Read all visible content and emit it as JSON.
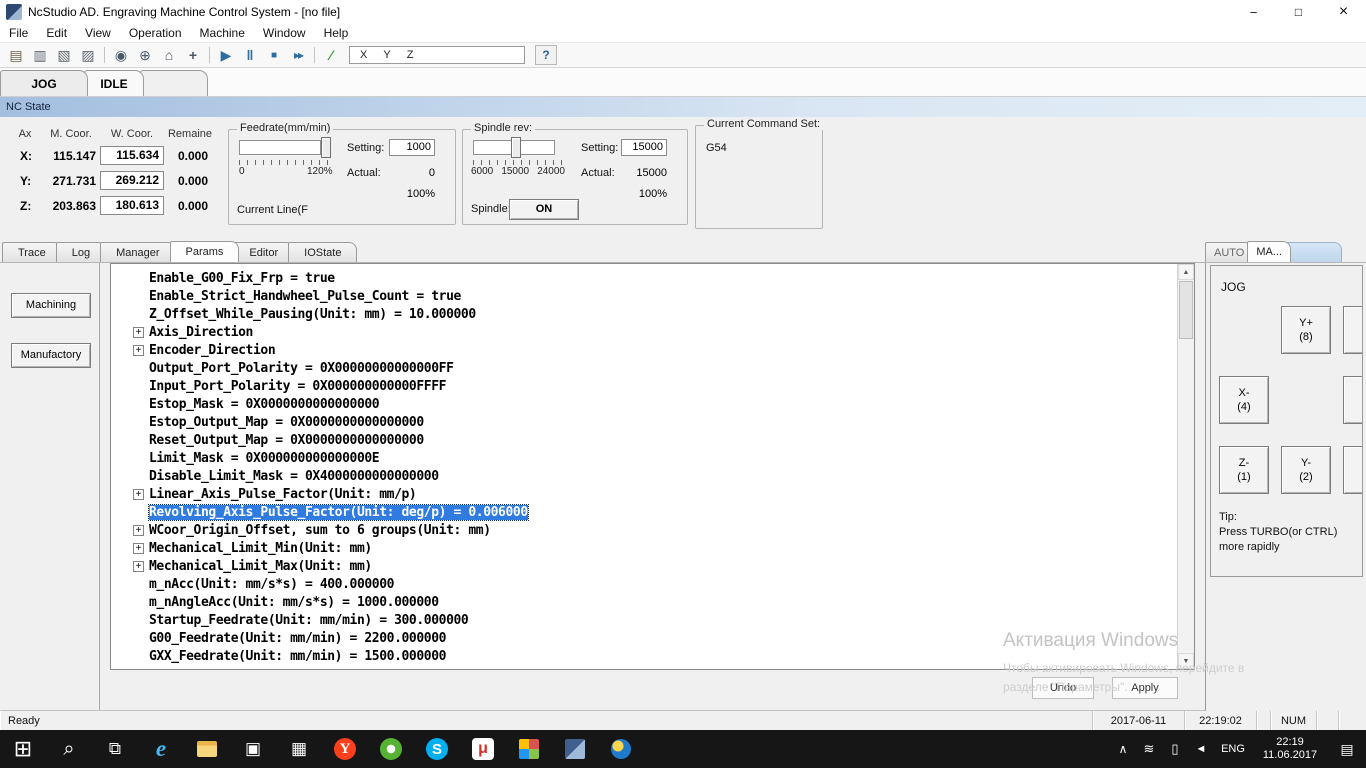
{
  "titlebar": {
    "title": "NcStudio AD. Engraving Machine Control System - [no file]"
  },
  "menubar": {
    "items": [
      {
        "label": "File"
      },
      {
        "label": "Edit"
      },
      {
        "label": "View"
      },
      {
        "label": "Operation"
      },
      {
        "label": "Machine"
      },
      {
        "label": "Window"
      },
      {
        "label": "Help"
      }
    ]
  },
  "toolbar": {
    "icons": [
      {
        "name": "open-file-icon",
        "glyph": "▤",
        "style": "color:#6b5f49",
        "inter": "true"
      },
      {
        "name": "save-icon",
        "glyph": "▥",
        "style": "color:#5f6670",
        "inter": "true"
      },
      {
        "name": "layout-icon",
        "glyph": "▧",
        "style": "color:#5f6670",
        "inter": "true"
      },
      {
        "name": "screen-icon",
        "glyph": "▨",
        "style": "color:#5f6670",
        "inter": "true"
      },
      {
        "name": "separator",
        "glyph": "",
        "style": "width:1px;height:16px;background:#c4c4c4;margin:0 4px",
        "inter": "false"
      },
      {
        "name": "handwheel-icon",
        "glyph": "◉",
        "style": "color:#4a5a6a",
        "inter": "true"
      },
      {
        "name": "origin-icon",
        "glyph": "⊕",
        "style": "color:#4a5a6a",
        "inter": "true"
      },
      {
        "name": "home-icon",
        "glyph": "⌂",
        "style": "color:#4a5a6a",
        "inter": "true"
      },
      {
        "name": "calibrate-icon",
        "glyph": "+",
        "style": "color:#4a5a6a;font-weight:bold",
        "inter": "true"
      },
      {
        "name": "separator",
        "glyph": "",
        "style": "width:1px;height:16px;background:#c4c4c4;margin:0 4px",
        "inter": "false"
      },
      {
        "name": "start-button",
        "glyph": "▶",
        "style": "color:#2e6da0",
        "inter": "true"
      },
      {
        "name": "pause-button",
        "glyph": "‖",
        "style": "color:#2e6da0;font-weight:bold",
        "inter": "true"
      },
      {
        "name": "stop-button",
        "glyph": "■",
        "style": "color:#2e6da0;font-size:10px",
        "inter": "true"
      },
      {
        "name": "resume-button",
        "glyph": "▸▸",
        "style": "color:#2e6da0;letter-spacing:-2px;font-size:12px",
        "inter": "true"
      },
      {
        "name": "separator",
        "glyph": "",
        "style": "width:1px;height:16px;background:#c4c4c4;margin:0 4px",
        "inter": "false"
      },
      {
        "name": "slash-icon",
        "glyph": "∕",
        "style": "color:#3f9f3f;font-weight:bold",
        "inter": "true"
      }
    ],
    "coord_labels": [
      {
        "label": "X"
      },
      {
        "label": "Y"
      },
      {
        "label": "Z"
      }
    ],
    "help_label": "?"
  },
  "mode_tabs": {
    "jog": "JOG",
    "idle": "IDLE"
  },
  "nc_state_label": "NC State",
  "coords": {
    "headers": {
      "axis": "Ax",
      "m": "M. Coor.",
      "w": "W. Coor.",
      "rem": "Remaine"
    },
    "rows": [
      {
        "axis": "X:",
        "m": "115.147",
        "w": "115.634",
        "rem": "0.000"
      },
      {
        "axis": "Y:",
        "m": "271.731",
        "w": "269.212",
        "rem": "0.000"
      },
      {
        "axis": "Z:",
        "m": "203.863",
        "w": "180.613",
        "rem": "0.000"
      }
    ]
  },
  "feedrate": {
    "title": "Feedrate(mm/min)",
    "scale_left": "0",
    "scale_right": "120%",
    "setting_label": "Setting:",
    "setting_value": "1000",
    "actual_label": "Actual:",
    "actual_value": "0",
    "percent": "100%",
    "current_line": "Current Line(F"
  },
  "spindle": {
    "title": "Spindle rev:",
    "scale": [
      {
        "label": "6000"
      },
      {
        "label": "15000"
      },
      {
        "label": "24000"
      }
    ],
    "setting_label": "Setting:",
    "setting_value": "15000",
    "actual_label": "Actual:",
    "actual_value": "15000",
    "percent": "100%",
    "spindle_label": "Spindle:",
    "on_label": "ON"
  },
  "command_set": {
    "title": "Current Command Set:",
    "value": "G54"
  },
  "bottom_tabs": {
    "items": [
      {
        "label": "Trace"
      },
      {
        "label": "Log"
      },
      {
        "label": "Manager"
      },
      {
        "label": "Params",
        "active": true
      },
      {
        "label": "Editor"
      },
      {
        "label": "IOState"
      }
    ]
  },
  "sidebar": {
    "machining": "Machining",
    "manufactory": "Manufactory"
  },
  "params": {
    "items": [
      {
        "text": "Enable_G00_Fix_Frp = true",
        "inter": "true"
      },
      {
        "text": "Enable_Strict_Handwheel_Pulse_Count = true",
        "inter": "true"
      },
      {
        "text": "Z_Offset_While_Pausing(Unit: mm) = 10.000000",
        "inter": "true"
      },
      {
        "text": "Axis_Direction",
        "expandable": true,
        "inter": "true"
      },
      {
        "text": "Encoder_Direction",
        "expandable": true,
        "inter": "true"
      },
      {
        "text": "Output_Port_Polarity = 0X00000000000000FF",
        "inter": "true"
      },
      {
        "text": "Input_Port_Polarity = 0X000000000000FFFF",
        "inter": "true"
      },
      {
        "text": "Estop_Mask = 0X0000000000000000",
        "inter": "true"
      },
      {
        "text": "Estop_Output_Map = 0X0000000000000000",
        "inter": "true"
      },
      {
        "text": "Reset_Output_Map = 0X0000000000000000",
        "inter": "true"
      },
      {
        "text": "Limit_Mask = 0X000000000000000E",
        "inter": "true"
      },
      {
        "text": "Disable_Limit_Mask = 0X4000000000000000",
        "inter": "true"
      },
      {
        "text": "Linear_Axis_Pulse_Factor(Unit: mm/p)",
        "expandable": true,
        "inter": "true"
      },
      {
        "text": "Revolving_Axis_Pulse_Factor(Unit: deg/p) = 0.006000",
        "selected": true,
        "inter": "true"
      },
      {
        "text": "WCoor_Origin_Offset, sum to 6 groups(Unit: mm)",
        "expandable": true,
        "inter": "true"
      },
      {
        "text": "Mechanical_Limit_Min(Unit: mm)",
        "expandable": true,
        "inter": "true"
      },
      {
        "text": "Mechanical_Limit_Max(Unit: mm)",
        "expandable": true,
        "inter": "true"
      },
      {
        "text": "m_nAcc(Unit: mm/s*s) = 400.000000",
        "inter": "true"
      },
      {
        "text": "m_nAngleAcc(Unit: mm/s*s) = 1000.000000",
        "inter": "true"
      },
      {
        "text": "Startup_Feedrate(Unit: mm/min) = 300.000000",
        "inter": "true"
      },
      {
        "text": "G00_Feedrate(Unit: mm/min) = 2200.000000",
        "inter": "true"
      },
      {
        "text": "GXX_Feedrate(Unit: mm/min) = 1500.000000",
        "inter": "true"
      }
    ]
  },
  "param_actions": {
    "undo": "Undo",
    "apply": "Apply"
  },
  "right_panel": {
    "tab_auto": "AUTO",
    "tab_ma": "MA...",
    "jog_label": "JOG",
    "buttons": [
      {
        "line1": "Y+",
        "line2": "(8)"
      },
      {
        "line1": "X-",
        "line2": "(4)"
      },
      {
        "line1": "Z-",
        "line2": "(1)"
      },
      {
        "line1": "Y-",
        "line2": "(2)"
      }
    ],
    "tip_title": "Tip:",
    "tip_line1": "Press TURBO(or CTRL)",
    "tip_line2": "more rapidly"
  },
  "watermark": {
    "line1": "Активация Windows",
    "line2": "Чтобы активировать Windows, перейдите в",
    "line3": "разделе \"Параметры\"."
  },
  "statusbar": {
    "ready": "Ready",
    "date": "2017-06-11",
    "time": "22:19:02",
    "num": "NUM"
  },
  "taskbar": {
    "icons": [
      {
        "name": "start-icon",
        "glyph": "⊞",
        "style": "color:#ffffff;font-size:22px",
        "inter": "true"
      },
      {
        "name": "search-icon",
        "glyph": "⌕",
        "style": "color:#ffffff;font-size:20px",
        "inter": "true"
      },
      {
        "name": "task-view-icon",
        "glyph": "⧉",
        "style": "color:#ffffff;font-size:17px",
        "inter": "true"
      },
      {
        "name": "edge-icon",
        "glyph": "e",
        "style": "color:#44b8f3;font-size:23px;font-weight:bold;font-style:italic;font-family:'Liberation Serif',serif",
        "inter": "true"
      },
      {
        "name": "file-explorer-icon",
        "glyph": "",
        "style": "width:20px;height:16px;background:linear-gradient(180deg,#e8b64c 28%,#f7d67c 28%);border-radius:2px",
        "inter": "true"
      },
      {
        "name": "store-icon",
        "glyph": "▣",
        "style": "color:#ffffff;font-size:17px",
        "inter": "true"
      },
      {
        "name": "calculator-icon",
        "glyph": "▦",
        "style": "color:#ffffff;font-size:17px",
        "inter": "true"
      },
      {
        "name": "yandex-icon",
        "glyph": "Y",
        "style": "width:22px;height:22px;background:#fc3f1d;border-radius:50%;color:#fff;font-weight:bold;font-family:'Liberation Serif',serif;font-size:15px",
        "inter": "true"
      },
      {
        "name": "antivirus-icon",
        "glyph": "",
        "style": "width:22px;height:22px;background:radial-gradient(#ffffff 0 4px,#55b232 4.5px);border-radius:50%",
        "inter": "true"
      },
      {
        "name": "skype-icon",
        "glyph": "S",
        "style": "width:22px;height:22px;background:#00aff0;border-radius:50%;color:#fff;font-weight:bold;font-size:15px",
        "inter": "true"
      },
      {
        "name": "mu-app-icon",
        "glyph": "μ",
        "style": "width:22px;height:22px;background:#ffffff;border-radius:4px;color:#d3302a;font-weight:bold;font-size:16px",
        "inter": "true"
      },
      {
        "name": "photos-grid-icon",
        "glyph": "",
        "style": "width:20px;height:20px;background:conic-gradient(#d9534f 0 25%,#8bc34a 0 50%,#2196f3 0 75%,#ffc107 0);border-radius:2px",
        "inter": "true"
      },
      {
        "name": "ncstudio-icon",
        "glyph": "",
        "style": "width:20px;height:20px;background:linear-gradient(135deg,#3f5f8f 0 50%,#9fb9d9 50%);border-radius:2px",
        "inter": "true"
      },
      {
        "name": "globe-app-icon",
        "glyph": "",
        "style": "width:20px;height:20px;background:radial-gradient(circle at 35% 35%,#ffd54f 0 5px,#1f7ac9 6px);border-radius:50%",
        "inter": "true"
      }
    ],
    "tray": [
      {
        "name": "tray-expand-icon",
        "glyph": "∧",
        "style": "color:#fff;font-size:12px",
        "inter": "true"
      },
      {
        "name": "tray-network-icon",
        "glyph": "≋",
        "style": "color:#fff;font-size:13px",
        "inter": "true"
      },
      {
        "name": "tray-battery-icon",
        "glyph": "▯",
        "style": "color:#fff;font-size:13px",
        "inter": "true"
      },
      {
        "name": "tray-volume-icon",
        "glyph": "◄",
        "style": "color:#fff;font-size:11px",
        "inter": "true"
      }
    ],
    "lang": "ENG",
    "time": "22:19",
    "date": "11.06.2017"
  }
}
